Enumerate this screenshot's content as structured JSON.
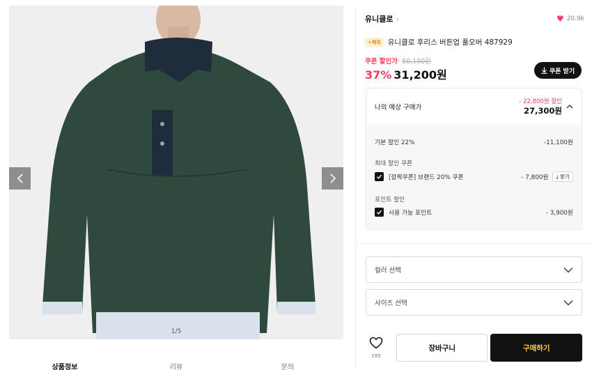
{
  "gallery": {
    "counter": "1/5",
    "prev_icon": "chevron-left-icon",
    "next_icon": "chevron-right-icon"
  },
  "tabs": [
    "상품정보",
    "리뷰",
    "문의"
  ],
  "brand": {
    "name": "유니클로",
    "likes": "20.9k"
  },
  "product": {
    "badge": "해외",
    "title": "유니클로 후리스 버튼업 풀오버 487929",
    "coupon_label": "쿠폰 할인가",
    "original_price": "50,100원",
    "discount_pct": "37%",
    "price": "31,200원",
    "coupon_button": "쿠폰 받기"
  },
  "estimate": {
    "label": "나의 예상 구매가",
    "discount": "- 22,800원 할인",
    "price": "27,300원",
    "base_discount_label": "기본 할인 22%",
    "base_discount_amount": "-11,100원",
    "coupon_section": "최대 할인 쿠폰",
    "coupon_name": "[깜짝쿠폰] 브랜드 20% 쿠폰",
    "coupon_amount": "- 7,800원",
    "coupon_get": "받기",
    "point_section": "포인트 할인",
    "point_name": "사용 가능 포인트",
    "point_amount": "- 3,900원"
  },
  "options": {
    "color_placeholder": "컬러 선택",
    "size_placeholder": "사이즈 선택"
  },
  "actions": {
    "wish_count": "185",
    "cart": "장바구니",
    "buy": "구매하기"
  },
  "colors": {
    "accent_red": "#ef3d5a",
    "buy_text": "#ffd14a",
    "fleece": "#2f4a3c"
  }
}
